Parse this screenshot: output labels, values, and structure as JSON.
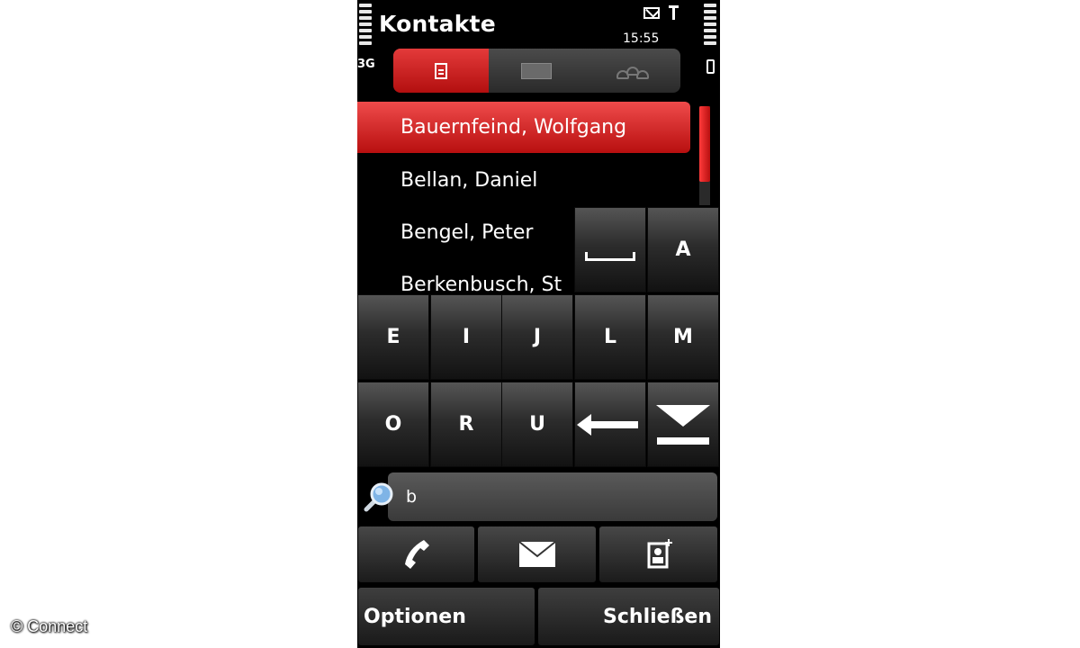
{
  "status": {
    "network": "3G",
    "time": "15:55",
    "envelope_icon": "envelope-icon",
    "antenna_icon": "antenna-icon"
  },
  "header": {
    "title": "Kontakte"
  },
  "tabs": [
    {
      "icon": "contacts-list-icon",
      "active": true
    },
    {
      "icon": "business-card-icon",
      "active": false
    },
    {
      "icon": "groups-icon",
      "active": false
    }
  ],
  "contacts": [
    {
      "name": "Bauernfeind, Wolfgang",
      "selected": true
    },
    {
      "name": "Bellan, Daniel",
      "selected": false
    },
    {
      "name": "Bengel, Peter",
      "selected": false
    },
    {
      "name": "Berkenbusch, St",
      "selected": false
    }
  ],
  "keypad": {
    "row1": [
      "",
      "A"
    ],
    "row2": [
      "E",
      "I",
      "J",
      "L",
      "M"
    ],
    "row3": [
      "O",
      "R",
      "U"
    ],
    "special": {
      "space": "space-icon",
      "backspace": "backspace-icon",
      "hide": "hide-keyboard-icon"
    }
  },
  "search": {
    "value": "b",
    "icon": "search-icon"
  },
  "actions": [
    {
      "icon": "call-icon"
    },
    {
      "icon": "message-icon"
    },
    {
      "icon": "new-contact-icon"
    }
  ],
  "softkeys": {
    "left": "Optionen",
    "right": "Schließen"
  },
  "watermark": "© Connect",
  "colors": {
    "accent": "#d42020",
    "background": "#000000"
  }
}
